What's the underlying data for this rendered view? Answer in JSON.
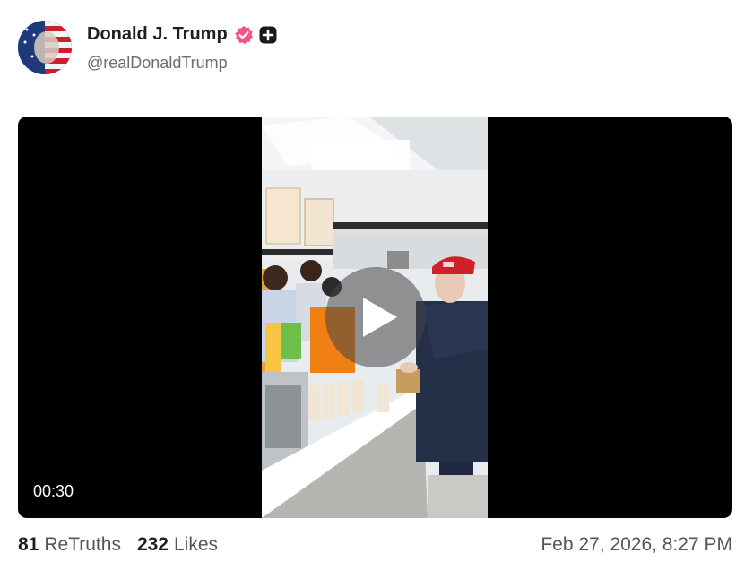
{
  "post": {
    "display_name": "Donald J. Trump",
    "handle": "@realDonaldTrump",
    "verified_icon": "verified-badge-icon",
    "plus_icon": "plus-square-icon",
    "accent_color": "#f2548a"
  },
  "video": {
    "duration": "00:30",
    "play_icon": "play-icon"
  },
  "stats": {
    "retruths_count": "81",
    "retruths_label": "ReTruths",
    "likes_count": "232",
    "likes_label": "Likes",
    "timestamp": "Feb 27, 2026, 8:27 PM"
  }
}
